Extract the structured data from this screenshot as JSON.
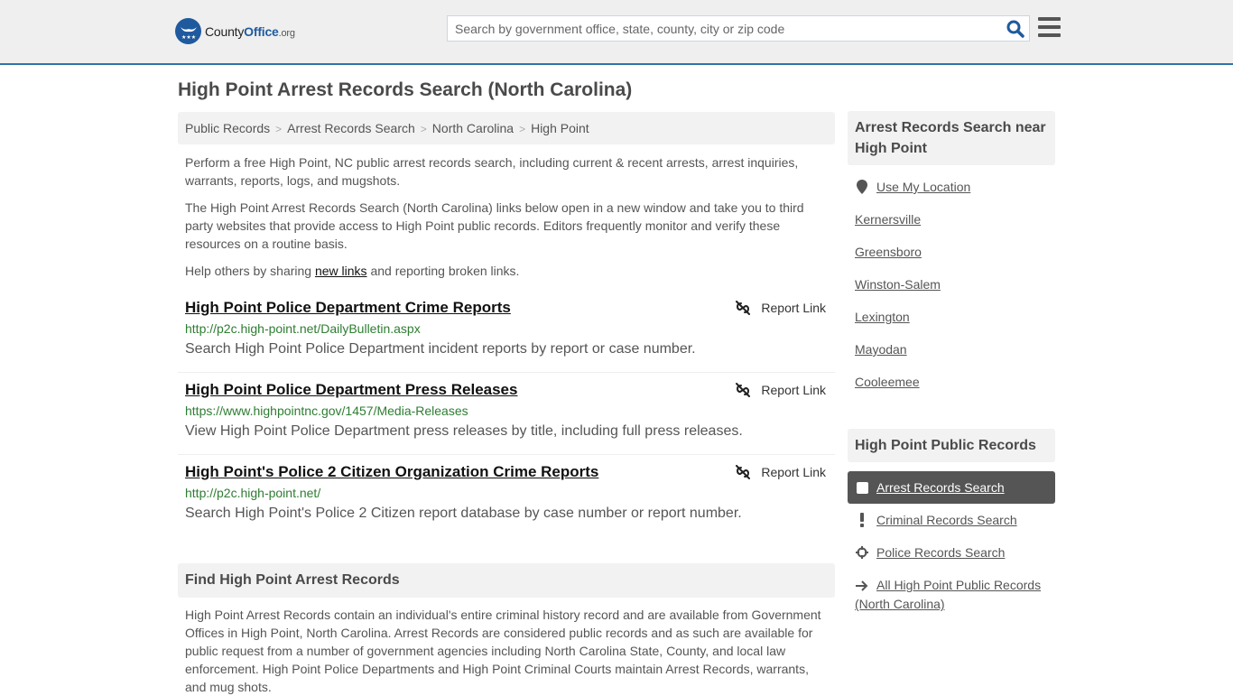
{
  "header": {
    "logo_text_plain": "County",
    "logo_text_bold": "Office",
    "logo_text_tld": ".org",
    "search_placeholder": "Search by government office, state, county, city or zip code",
    "search_icon": "search-icon",
    "menu_icon": "hamburger-menu-icon"
  },
  "page_title": "High Point Arrest Records Search (North Carolina)",
  "breadcrumb": [
    {
      "label": "Public Records"
    },
    {
      "label": "Arrest Records Search"
    },
    {
      "label": "North Carolina"
    },
    {
      "label": "High Point"
    }
  ],
  "intro": {
    "p1": "Perform a free High Point, NC public arrest records search, including current & recent arrests, arrest inquiries, warrants, reports, logs, and mugshots.",
    "p2": "The High Point Arrest Records Search (North Carolina) links below open in a new window and take you to third party websites that provide access to High Point public records. Editors frequently monitor and verify these resources on a routine basis.",
    "p3_before": "Help others by sharing ",
    "p3_link": "new links",
    "p3_after": " and reporting broken links."
  },
  "links": [
    {
      "title": "High Point Police Department Crime Reports",
      "url": "http://p2c.high-point.net/DailyBulletin.aspx",
      "description": "Search High Point Police Department incident reports by report or case number.",
      "report_label": "Report Link"
    },
    {
      "title": "High Point Police Department Press Releases",
      "url": "https://www.highpointnc.gov/1457/Media-Releases",
      "description": "View High Point Police Department press releases by title, including full press releases.",
      "report_label": "Report Link"
    },
    {
      "title": "High Point's Police 2 Citizen Organization Crime Reports",
      "url": "http://p2c.high-point.net/",
      "description": "Search High Point's Police 2 Citizen report database by case number or report number.",
      "report_label": "Report Link"
    }
  ],
  "find_section": {
    "heading": "Find High Point Arrest Records",
    "body": "High Point Arrest Records contain an individual's entire criminal history record and are available from Government Offices in High Point, North Carolina. Arrest Records are considered public records and as such are available for public request from a number of government agencies including North Carolina State, County, and local law enforcement. High Point Police Departments and High Point Criminal Courts maintain Arrest Records, warrants, and mug shots."
  },
  "sidebar": {
    "nearby_heading": "Arrest Records Search near High Point",
    "use_location": "Use My Location",
    "nearby": [
      "Kernersville",
      "Greensboro",
      "Winston-Salem",
      "Lexington",
      "Mayodan",
      "Cooleemee"
    ],
    "public_heading": "High Point Public Records",
    "public_items": [
      {
        "label": "Arrest Records Search",
        "icon": "square-icon",
        "active": true
      },
      {
        "label": "Criminal Records Search",
        "icon": "exclamation-icon",
        "active": false
      },
      {
        "label": "Police Records Search",
        "icon": "crosshair-icon",
        "active": false
      },
      {
        "label": "All High Point Public Records (North Carolina)",
        "icon": "arrow-right-icon",
        "active": false
      }
    ]
  }
}
